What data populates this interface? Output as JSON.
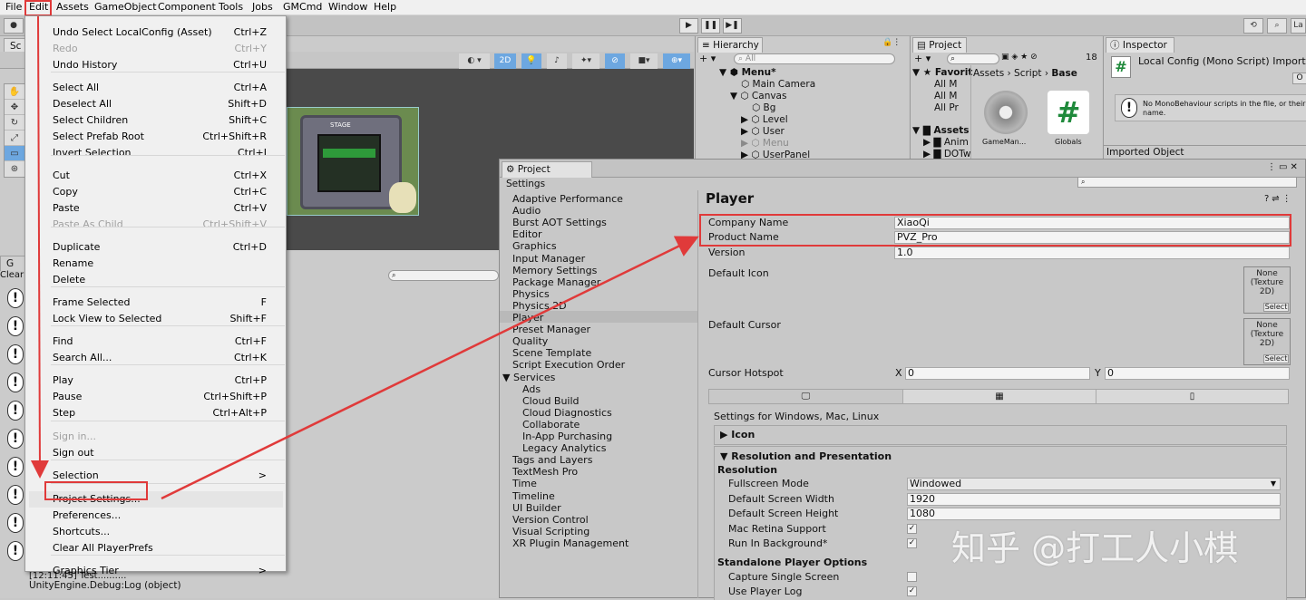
{
  "menubar": [
    "File",
    "Edit",
    "Assets",
    "GameObject",
    "Component",
    "Tools",
    "Jobs",
    "GMCmd",
    "Window",
    "Help"
  ],
  "edit_menu": [
    {
      "label": "Undo Select LocalConfig (Asset)",
      "shortcut": "Ctrl+Z",
      "disabled": false
    },
    {
      "label": "Redo",
      "shortcut": "Ctrl+Y",
      "disabled": true
    },
    {
      "label": "Undo History",
      "shortcut": "Ctrl+U",
      "disabled": false
    },
    {
      "label": "Select All",
      "shortcut": "Ctrl+A",
      "disabled": false
    },
    {
      "label": "Deselect All",
      "shortcut": "Shift+D",
      "disabled": false
    },
    {
      "label": "Select Children",
      "shortcut": "Shift+C",
      "disabled": false
    },
    {
      "label": "Select Prefab Root",
      "shortcut": "Ctrl+Shift+R",
      "disabled": false
    },
    {
      "label": "Invert Selection",
      "shortcut": "Ctrl+I",
      "disabled": false
    },
    {
      "label": "Cut",
      "shortcut": "Ctrl+X",
      "disabled": false
    },
    {
      "label": "Copy",
      "shortcut": "Ctrl+C",
      "disabled": false
    },
    {
      "label": "Paste",
      "shortcut": "Ctrl+V",
      "disabled": false
    },
    {
      "label": "Paste As Child",
      "shortcut": "Ctrl+Shift+V",
      "disabled": true
    },
    {
      "label": "Duplicate",
      "shortcut": "Ctrl+D",
      "disabled": false
    },
    {
      "label": "Rename",
      "shortcut": "",
      "disabled": false
    },
    {
      "label": "Delete",
      "shortcut": "",
      "disabled": false
    },
    {
      "label": "Frame Selected",
      "shortcut": "F",
      "disabled": false
    },
    {
      "label": "Lock View to Selected",
      "shortcut": "Shift+F",
      "disabled": false
    },
    {
      "label": "Find",
      "shortcut": "Ctrl+F",
      "disabled": false
    },
    {
      "label": "Search All...",
      "shortcut": "Ctrl+K",
      "disabled": false
    },
    {
      "label": "Play",
      "shortcut": "Ctrl+P",
      "disabled": false
    },
    {
      "label": "Pause",
      "shortcut": "Ctrl+Shift+P",
      "disabled": false
    },
    {
      "label": "Step",
      "shortcut": "Ctrl+Alt+P",
      "disabled": false
    },
    {
      "label": "Sign in...",
      "shortcut": "",
      "disabled": true
    },
    {
      "label": "Sign out",
      "shortcut": "",
      "disabled": false
    },
    {
      "label": "Selection",
      "shortcut": ">",
      "disabled": false
    },
    {
      "label": "Project Settings...",
      "shortcut": "",
      "disabled": false
    },
    {
      "label": "Preferences...",
      "shortcut": "",
      "disabled": false
    },
    {
      "label": "Shortcuts...",
      "shortcut": "",
      "disabled": false
    },
    {
      "label": "Clear All PlayerPrefs",
      "shortcut": "",
      "disabled": false
    },
    {
      "label": "Graphics Tier",
      "shortcut": ">",
      "disabled": false
    }
  ],
  "toolbar": {
    "play": "▶",
    "pause": "❚❚",
    "step": "▶❚",
    "history": "⟲",
    "search": "🔍",
    "layers": "La"
  },
  "scene": {
    "tab": "Sc",
    "mode2d": "2D",
    "game_title": "STAGE"
  },
  "console": {
    "tab": "G",
    "clear": "Clear",
    "search_placeholder": "",
    "last_log": "[12:11:45] Test..........",
    "last_log_src": "UnityEngine.Debug:Log (object)"
  },
  "hierarchy": {
    "tab": "Hierarchy",
    "search": "All",
    "rows": [
      "Menu*",
      "Main Camera",
      "Canvas",
      "Bg",
      "Level",
      "User",
      "Menu",
      "UserPanel"
    ]
  },
  "project": {
    "tab": "Project",
    "count": "18",
    "favorites": "Favorit",
    "fav_items": [
      "All M",
      "All M",
      "All Pr"
    ],
    "assets": "Assets",
    "asset_items": [
      "Anim",
      "DOTw"
    ],
    "breadcrumb": [
      "Assets",
      "Script",
      "Base"
    ],
    "files": [
      "GameMan...",
      "Globals"
    ]
  },
  "inspector": {
    "tab": "Inspector",
    "title": "Local Config (Mono Script) Import Se",
    "warning": "No MonoBehaviour scripts in the file, or their name.",
    "imported": "Imported Object",
    "open_btn": "O"
  },
  "project_settings": {
    "title": "Project Settings",
    "nav": [
      "Adaptive Performance",
      "Audio",
      "Burst AOT Settings",
      "Editor",
      "Graphics",
      "Input Manager",
      "Memory Settings",
      "Package Manager",
      "Physics",
      "Physics 2D",
      "Player",
      "Preset Manager",
      "Quality",
      "Scene Template",
      "Script Execution Order",
      "Services",
      "Ads",
      "Cloud Build",
      "Cloud Diagnostics",
      "Collaborate",
      "In-App Purchasing",
      "Legacy Analytics",
      "Tags and Layers",
      "TextMesh Pro",
      "Time",
      "Timeline",
      "UI Builder",
      "Version Control",
      "Visual Scripting",
      "XR Plugin Management"
    ],
    "heading": "Player",
    "company_label": "Company Name",
    "company_value": "XiaoQi",
    "product_label": "Product Name",
    "product_value": "PVZ_Pro",
    "version_label": "Version",
    "version_value": "1.0",
    "default_icon": "Default Icon",
    "default_cursor": "Default Cursor",
    "none_texture": "None (Texture 2D)",
    "select": "Select",
    "cursor_hotspot": "Cursor Hotspot",
    "x_label": "X",
    "x_value": "0",
    "y_label": "Y",
    "y_value": "0",
    "platform_settings": "Settings for Windows, Mac, Linux",
    "icon_section": "Icon",
    "resolution_section": "Resolution and Presentation",
    "resolution_sub": "Resolution",
    "fullscreen_label": "Fullscreen Mode",
    "fullscreen_value": "Windowed",
    "width_label": "Default Screen Width",
    "width_value": "1920",
    "height_label": "Default Screen Height",
    "height_value": "1080",
    "retina_label": "Mac Retina Support",
    "runbg_label": "Run In Background*",
    "standalone_sub": "Standalone Player Options",
    "capture_label": "Capture Single Screen",
    "playerlog_label": "Use Player Log"
  },
  "watermark": "知乎 @打工人小棋",
  "colors": {
    "highlight": "#e03a3a",
    "selected_row": "#b9b9b9",
    "menu_hover": "#e5e5e5"
  }
}
